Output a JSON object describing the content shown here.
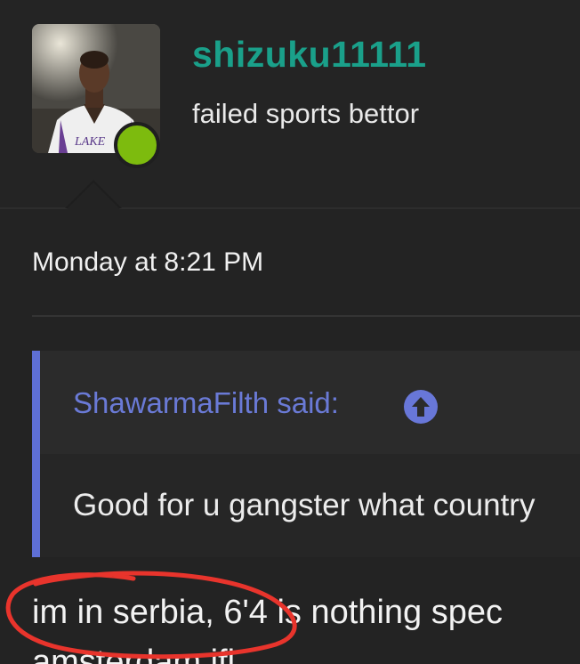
{
  "user": {
    "username": "shizuku11111",
    "title": "failed sports bettor",
    "avatar_icon": "user-avatar-icon",
    "status": "online",
    "status_color": "#7dbb0e"
  },
  "post": {
    "timestamp": "Monday at 8:21 PM",
    "quote": {
      "author_label": "ShawarmaFilth said:",
      "jump_icon": "arrow-up-circle-icon",
      "text": "Good for u gangster what country"
    },
    "message_lines": [
      "im in serbia, 6'4 is nothing spec",
      "amsterdam ifl"
    ]
  },
  "colors": {
    "username": "#1aa08a",
    "quote_accent": "#5e6fd6",
    "annotation": "#e8342c"
  }
}
